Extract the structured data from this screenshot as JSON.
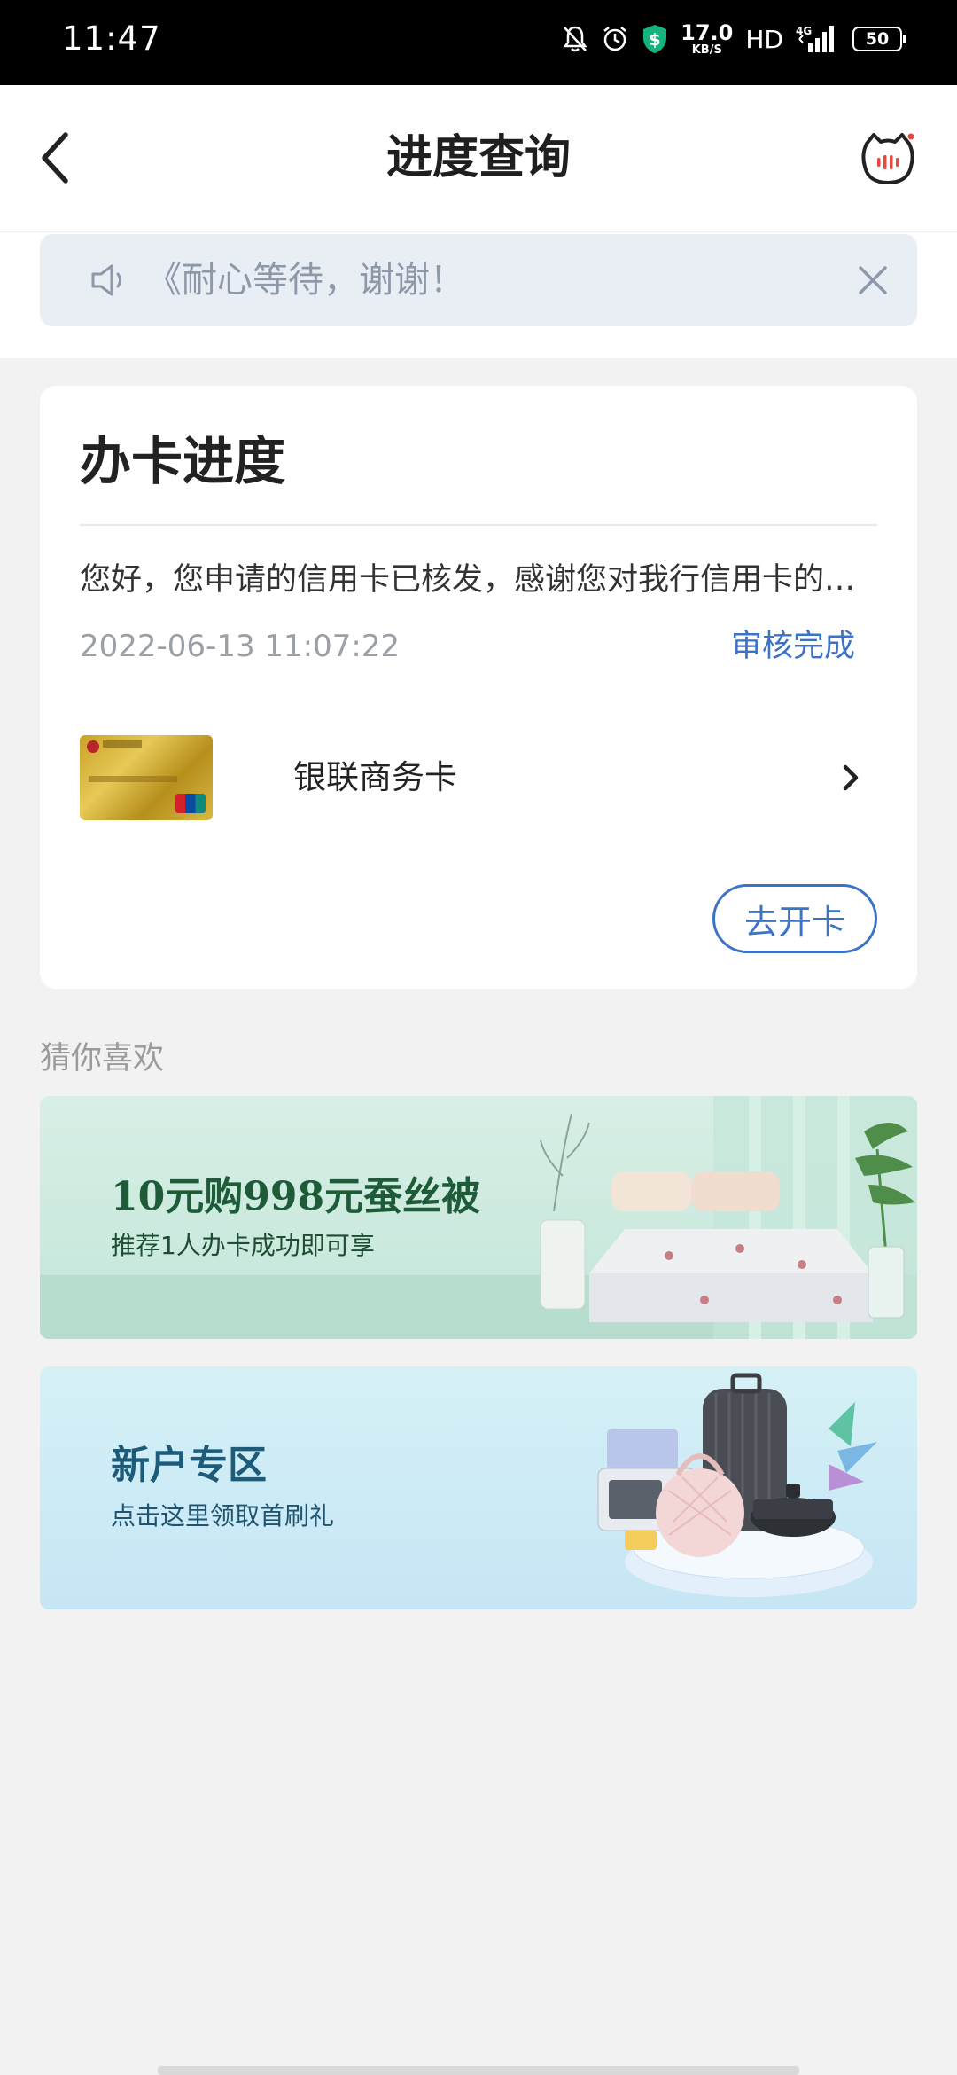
{
  "status_bar": {
    "time": "11:47",
    "net_speed_value": "17.0",
    "net_speed_unit": "KB/S",
    "hd": "HD",
    "network_type": "4G",
    "battery": "50"
  },
  "header": {
    "title": "进度查询"
  },
  "notice": {
    "text": "《耐心等待，谢谢！"
  },
  "progress_card": {
    "title": "办卡进度",
    "message": "您好，您申请的信用卡已核发，感谢您对我行信用卡的…",
    "timestamp": "2022-06-13 11:07:22",
    "status": "审核完成",
    "card_name": "银联商务卡",
    "open_card_button": "去开卡"
  },
  "recommendations": {
    "title": "猜你喜欢",
    "banners": [
      {
        "headline": "10元购998元蚕丝被",
        "subline": "推荐1人办卡成功即可享"
      },
      {
        "headline": "新户专区",
        "subline": "点击这里领取首刷礼"
      }
    ]
  },
  "colors": {
    "accent": "#3c73c7",
    "notice_bg": "#e9eef4",
    "page_bg": "#f2f2f2"
  },
  "icons": [
    "back-arrow-icon",
    "cat-service-icon",
    "speaker-icon",
    "close-icon",
    "chevron-right-icon"
  ]
}
